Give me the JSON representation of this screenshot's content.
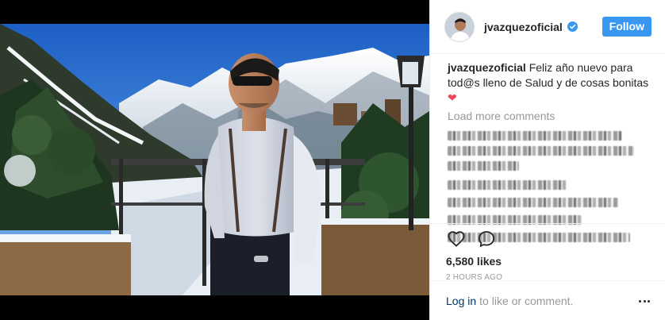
{
  "post": {
    "username": "jvazquezoficial",
    "verified": true,
    "follow_label": "Follow",
    "caption_user": "jvazquezoficial",
    "caption_text": "Feliz año nuevo para tod@s lleno de Salud y de cosas bonitas",
    "caption_emoji": "❤",
    "load_more_label": "Load more comments",
    "likes_text": "6,580 likes",
    "timestamp": "2 HOURS AGO",
    "login_link": "Log in",
    "login_suffix": "to like or comment."
  },
  "blurred_comment_count": 7,
  "icons": {
    "like": "heart-outline-icon",
    "comment": "speech-bubble-icon",
    "verified": "verified-badge-icon",
    "more": "more-options-icon"
  },
  "colors": {
    "accent": "#3897f0",
    "link": "#003569",
    "muted": "#999999",
    "heart": "#ed4956"
  }
}
